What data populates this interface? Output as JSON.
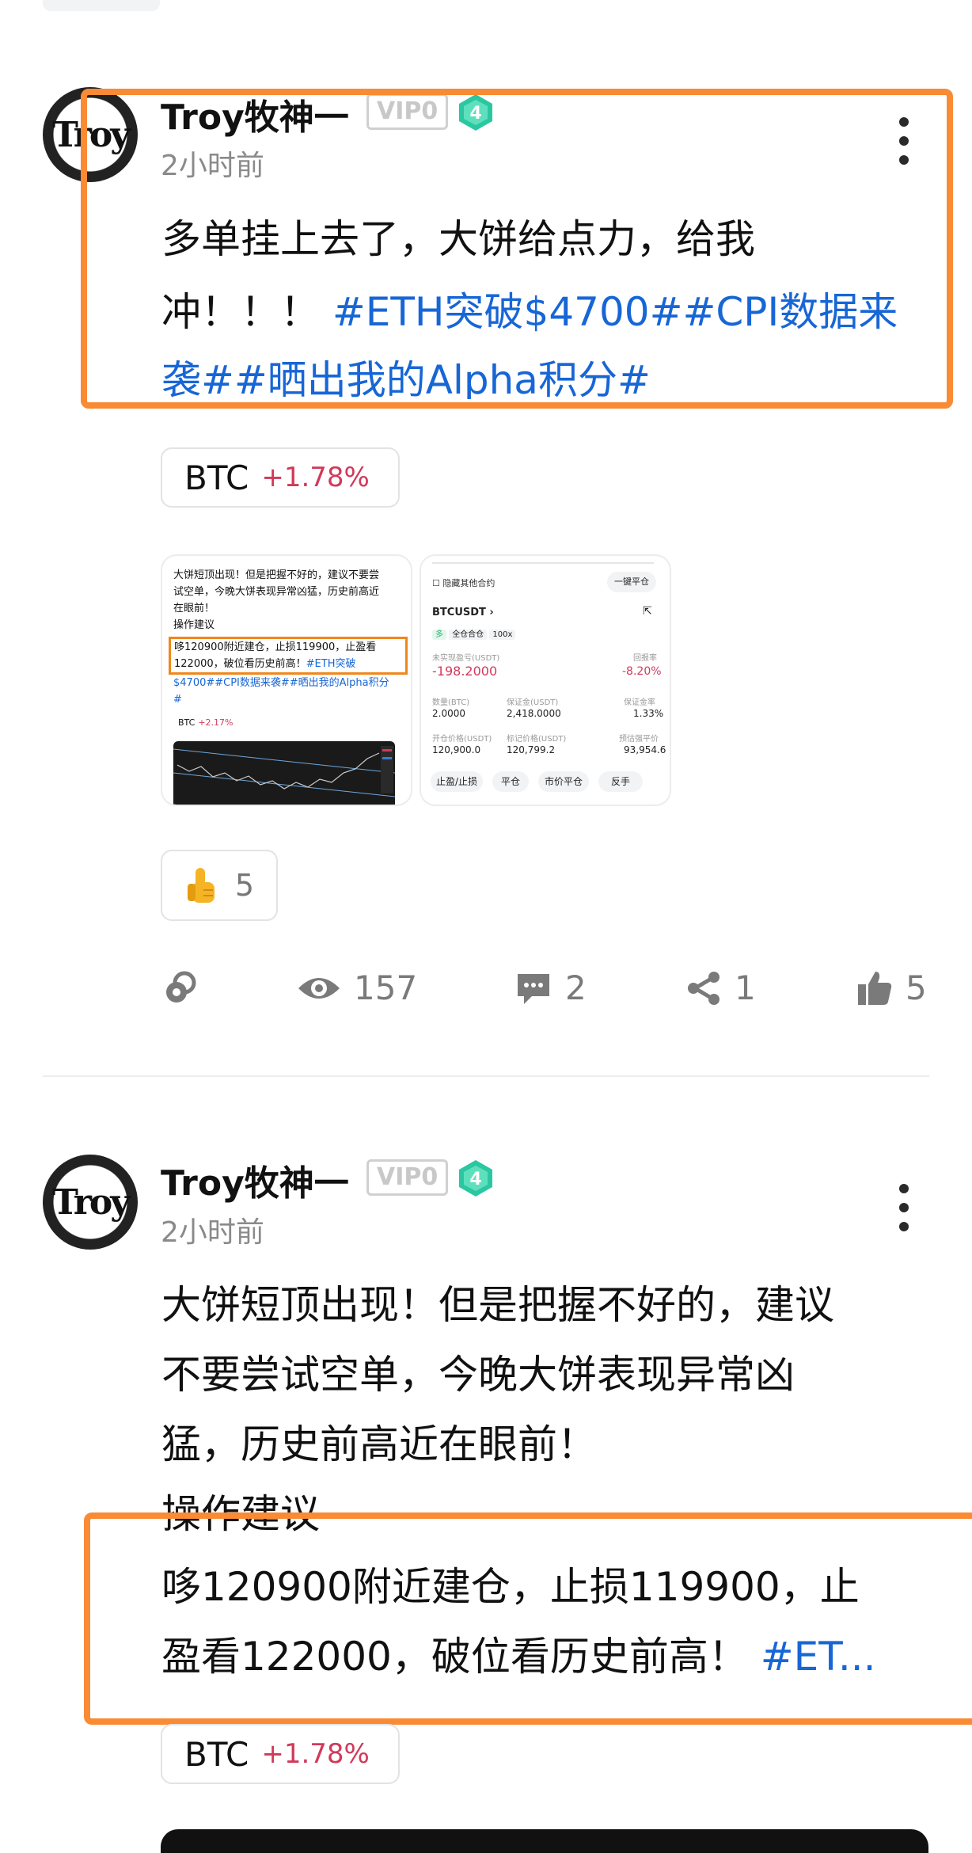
{
  "post1": {
    "avatar_text": "Troy",
    "author": "Troy牧神一",
    "vip": "VIP0",
    "level": "4",
    "time": "2小时前",
    "text_line1": "多单挂上去了，大饼给点力，给我",
    "text_line2_plain": "冲！！！",
    "text_line2_tag": "#ETH突破$4700##CPI数据来",
    "text_line3_tag": "袭##晒出我的Alpha积分#",
    "chip": {
      "symbol": "BTC",
      "change": "+1.78%"
    },
    "image1": {
      "line1": "大饼短顶出现！但是把握不好的，建议不要尝",
      "line2": "试空单，今晚大饼表现异常凶猛，历史前高近",
      "line3": "在眼前！",
      "line4": "操作建议",
      "box1": "哆120900附近建仓，止损119900，止盈看",
      "box2_plain": "122000，破位看历史前高！",
      "box2_tag": "#ETH突破",
      "tag_line1": "$4700##CPI数据来袭##晒出我的Alpha积分",
      "tag_line2": "#",
      "chip_symbol": "BTC",
      "chip_change": "+2.17%"
    },
    "image2": {
      "hide_label": "隐藏其他合约",
      "close_all": "一键平仓",
      "pair": "BTCUSDT",
      "mode_cross": "全仓合仓",
      "leverage": "100x",
      "unrealized_label": "未实现盈亏(USDT)",
      "roe_label": "回报率",
      "unrealized": "-198.2000",
      "roe": "-8.20%",
      "size_label": "数量(BTC)",
      "margin_label": "保证金(USDT)",
      "margin_ratio_label": "保证金率",
      "size": "2.0000",
      "margin": "2,418.0000",
      "margin_ratio": "1.33%",
      "entry_label": "开仓价格(USDT)",
      "mark_label": "标记价格(USDT)",
      "liq_label": "预估强平价",
      "entry": "120,900.0",
      "mark": "120,799.2",
      "liq": "93,954.6",
      "btn_tpsl": "止盈/止损",
      "btn_close": "平仓",
      "btn_market_close": "市价平仓",
      "btn_reverse": "反手"
    },
    "reaction_count": "5",
    "stats": {
      "views": "157",
      "comments": "2",
      "shares": "1",
      "likes": "5"
    }
  },
  "post2": {
    "avatar_text": "Troy",
    "author": "Troy牧神一",
    "vip": "VIP0",
    "level": "4",
    "time": "2小时前",
    "line1": "大饼短顶出现！但是把握不好的，建议",
    "line2": "不要尝试空单，今晚大饼表现异常凶",
    "line3": "猛，历史前高近在眼前！",
    "line4": "操作建议",
    "line5": "哆120900附近建仓，止损119900，止",
    "line6_plain": "盈看122000，破位看历史前高！",
    "line6_tag": "#ET...",
    "chip": {
      "symbol": "BTC",
      "change": "+1.78%"
    }
  },
  "colors": {
    "accent_blue": "#1766d6",
    "positive_red": "#d2395a",
    "highlight_orange": "#f98b34"
  }
}
